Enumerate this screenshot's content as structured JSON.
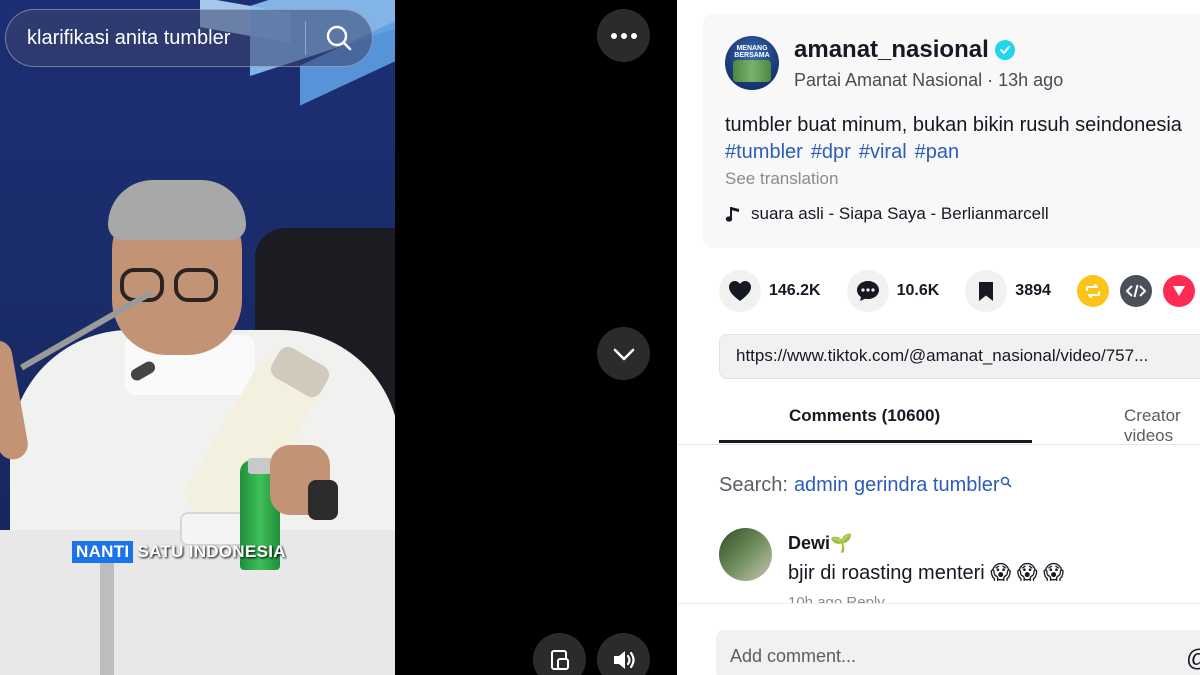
{
  "search": {
    "query": "klarifikasi anita tumbler"
  },
  "video": {
    "caption_highlight": "NANTI",
    "caption_rest": "SATU INDONESIA"
  },
  "avatar_text": "MENANG BERSAMA",
  "post": {
    "username": "amanat_nasional",
    "display_name": "Partai Amanat Nasional",
    "time_ago": "13h ago",
    "separator": "·",
    "description": "tumbler buat minum, bukan bikin rusuh seindonesia",
    "hashtags": [
      "#tumbler",
      "#dpr",
      "#viral",
      "#pan"
    ],
    "see_translation": "See translation",
    "music": "suara asli - Siapa Saya - Berlianmarcell"
  },
  "stats": {
    "likes": "146.2K",
    "comments": "10.6K",
    "saves": "3894"
  },
  "link": "https://www.tiktok.com/@amanat_nasional/video/757...",
  "tabs": [
    {
      "label": "Comments (10600)"
    },
    {
      "label": "Creator videos"
    }
  ],
  "search_related": {
    "prefix": "Search:",
    "query": "admin gerindra tumbler"
  },
  "comments": [
    {
      "name": "Dewi🌱",
      "text": "bjir di roasting menteri 😱 😱 😱",
      "meta": "10h ago    Reply"
    }
  ],
  "add_comment": {
    "placeholder": "Add comment...",
    "at_symbol": "@"
  },
  "colors": {
    "accent": "#fe2c55",
    "link": "#2b5db9",
    "verified": "#20d5ec",
    "repost": "#fcc419"
  },
  "icons": [
    "search-icon",
    "more-icon",
    "chevron-down-icon",
    "volume-icon",
    "miniplayer-icon",
    "verified-icon",
    "music-icon",
    "heart-icon",
    "comment-icon",
    "bookmark-icon",
    "repost-icon",
    "embed-icon",
    "share-icon"
  ]
}
